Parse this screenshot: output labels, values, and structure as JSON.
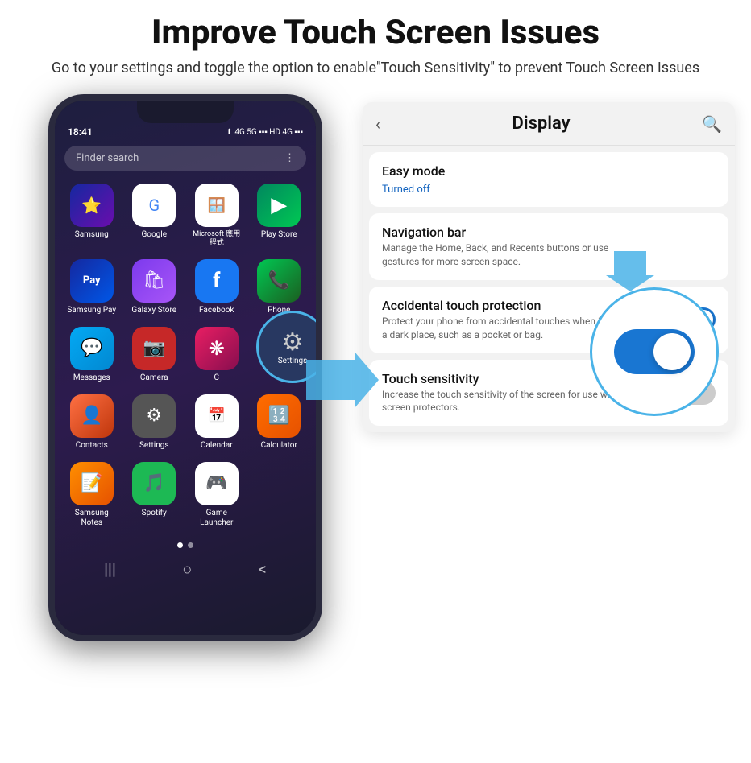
{
  "header": {
    "title": "Improve Touch Screen Issues",
    "subtitle": "Go to your settings and toggle the option to enable\"Touch Sensitivity\" to prevent Touch Screen Issues"
  },
  "phone": {
    "statusBar": {
      "time": "18:41",
      "indicators": "⬆ 4G 5G .ull HD 4G .ull"
    },
    "searchPlaceholder": "Finder search",
    "apps": [
      {
        "label": "Samsung",
        "icon": "⭐",
        "bg": "samsung"
      },
      {
        "label": "Google",
        "icon": "G",
        "bg": "google"
      },
      {
        "label": "Microsoft 應用程式",
        "icon": "🪟",
        "bg": "microsoft"
      },
      {
        "label": "Play Store",
        "icon": "▶",
        "bg": "playstore"
      },
      {
        "label": "Samsung Pay",
        "icon": "Pay",
        "bg": "pay"
      },
      {
        "label": "Galaxy Store",
        "icon": "🛍",
        "bg": "galaxy"
      },
      {
        "label": "Facebook",
        "icon": "f",
        "bg": "facebook"
      },
      {
        "label": "Phone",
        "icon": "📞",
        "bg": "phone"
      },
      {
        "label": "Messages",
        "icon": "💬",
        "bg": "messages"
      },
      {
        "label": "Camera",
        "icon": "📷",
        "bg": "camera"
      },
      {
        "label": "C",
        "icon": "❋",
        "bg": "bixby"
      },
      {
        "label": "Settings",
        "icon": "⚙",
        "bg": "settings-dark"
      },
      {
        "label": "Contacts",
        "icon": "👤",
        "bg": "contacts"
      },
      {
        "label": "Settings",
        "icon": "⚙",
        "bg": "settings"
      },
      {
        "label": "Calendar",
        "icon": "📅",
        "bg": "calendar"
      },
      {
        "label": "Calculator",
        "icon": "🔢",
        "bg": "calc"
      },
      {
        "label": "Samsung Notes",
        "icon": "📝",
        "bg": "notes"
      },
      {
        "label": "Spotify",
        "icon": "🎵",
        "bg": "spotify"
      },
      {
        "label": "Game Launcher",
        "icon": "🎮",
        "bg": "game"
      }
    ],
    "magnifyLabel": "Settings",
    "navDots": [
      "active",
      "inactive"
    ],
    "navButtons": [
      "|||",
      "○",
      "<"
    ]
  },
  "displayPanel": {
    "backIcon": "‹",
    "title": "Display",
    "searchIcon": "🔍",
    "sections": [
      {
        "items": [
          {
            "title": "Easy mode",
            "subtitle": "Turned off",
            "subtitleColor": "#1565c0",
            "hasToggle": false
          }
        ]
      },
      {
        "items": [
          {
            "title": "Navigation bar",
            "subtitle": "Manage the Home, Back, and Recents buttons or use gestures for more screen space.",
            "hasToggle": false
          }
        ]
      },
      {
        "items": [
          {
            "title": "Accidental touch protection",
            "subtitle": "Protect your phone from accidental touches when it's in a dark place, such as a pocket or bag.",
            "hasToggle": true,
            "toggleOn": true
          }
        ]
      },
      {
        "items": [
          {
            "title": "Touch sensitivity",
            "subtitle": "Increase the touch sensitivity of the screen for use with screen protectors.",
            "hasToggle": true,
            "toggleOn": false
          }
        ]
      }
    ]
  }
}
